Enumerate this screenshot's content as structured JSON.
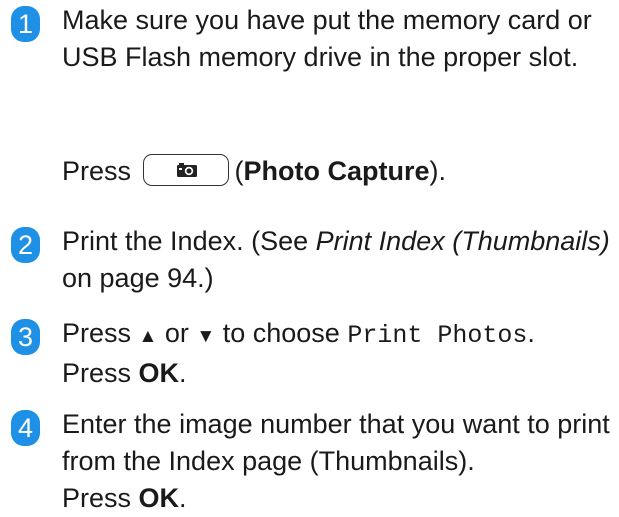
{
  "steps": [
    {
      "number": "1",
      "text1": "Make sure you have put the memory card or USB Flash memory drive in the proper slot.",
      "press_word": "Press",
      "button_icon": "camera-icon",
      "button_open": "(",
      "button_name": "Photo Capture",
      "button_close": ")."
    },
    {
      "number": "2",
      "prefix": "Print the Index. (See ",
      "link_text": "Print Index (Thumbnails)",
      "suffix": " on page 94.)"
    },
    {
      "number": "3",
      "press_word": "Press",
      "up_arrow": "▲",
      "or_word": "or",
      "down_arrow": "▼",
      "choose_text": "to choose",
      "lcd_text": "Print Photos",
      "period": ".",
      "press2": "Press",
      "ok": "OK",
      "ok_period": "."
    },
    {
      "number": "4",
      "text": "Enter the image number that you want to print from the Index page (Thumbnails).",
      "press": "Press",
      "ok": "OK",
      "ok_period": "."
    }
  ],
  "colors": {
    "badge": "#1e90e6",
    "text": "#1a1a1a"
  }
}
